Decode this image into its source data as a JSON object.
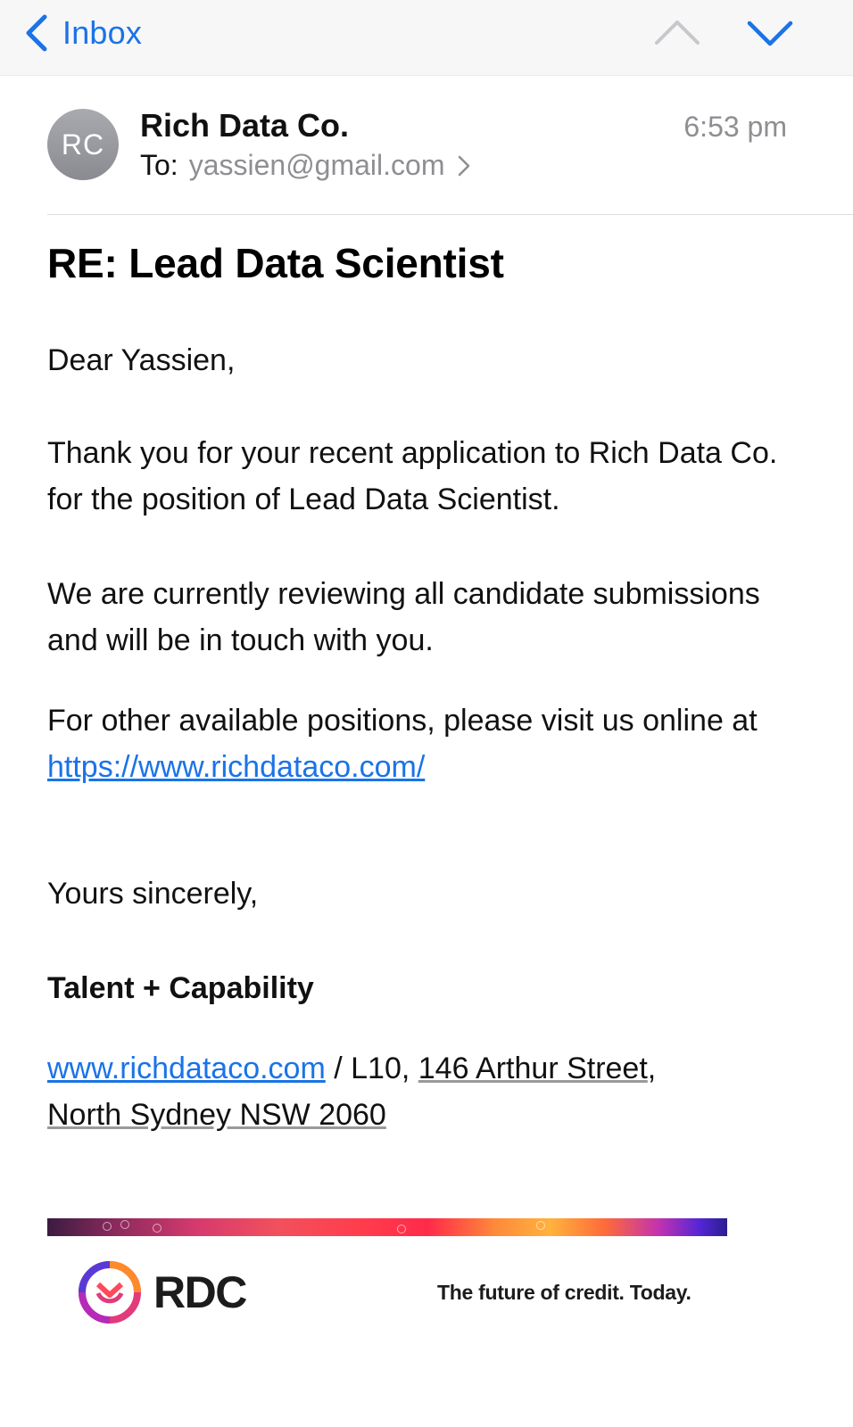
{
  "nav": {
    "back_label": "Inbox",
    "back_icon": "chevron-left-icon",
    "prev_icon": "chevron-up-icon",
    "next_icon": "chevron-down-icon"
  },
  "header": {
    "avatar_initials": "RC",
    "sender": "Rich Data Co.",
    "to_label": "To:",
    "to_email": "yassien@gmail.com",
    "time": "6:53 pm"
  },
  "email": {
    "subject": "RE: Lead Data Scientist",
    "greeting": "Dear Yassien,",
    "thanks": "Thank you for your recent application to Rich Data Co. for the position of Lead Data Scientist.",
    "review": "We are currently reviewing all candidate submissions and will be in touch with you.",
    "other_prefix": "For other available positions, please visit us online at",
    "other_link": "https://www.richdataco.com/",
    "closing": "Yours sincerely,",
    "signoff": "Talent + Capability",
    "address_link": "www.richdataco.com",
    "address_sep": " / L10, ",
    "address_street": "146 Arthur Street",
    "address_comma": ",",
    "address_city": "North Sydney NSW 2060"
  },
  "footer": {
    "logo_text": "RDC",
    "tagline": "The future of credit. Today."
  },
  "colors": {
    "accent": "#1a73e8",
    "muted": "#8e8e93",
    "avatar": "#9b9ca2"
  }
}
